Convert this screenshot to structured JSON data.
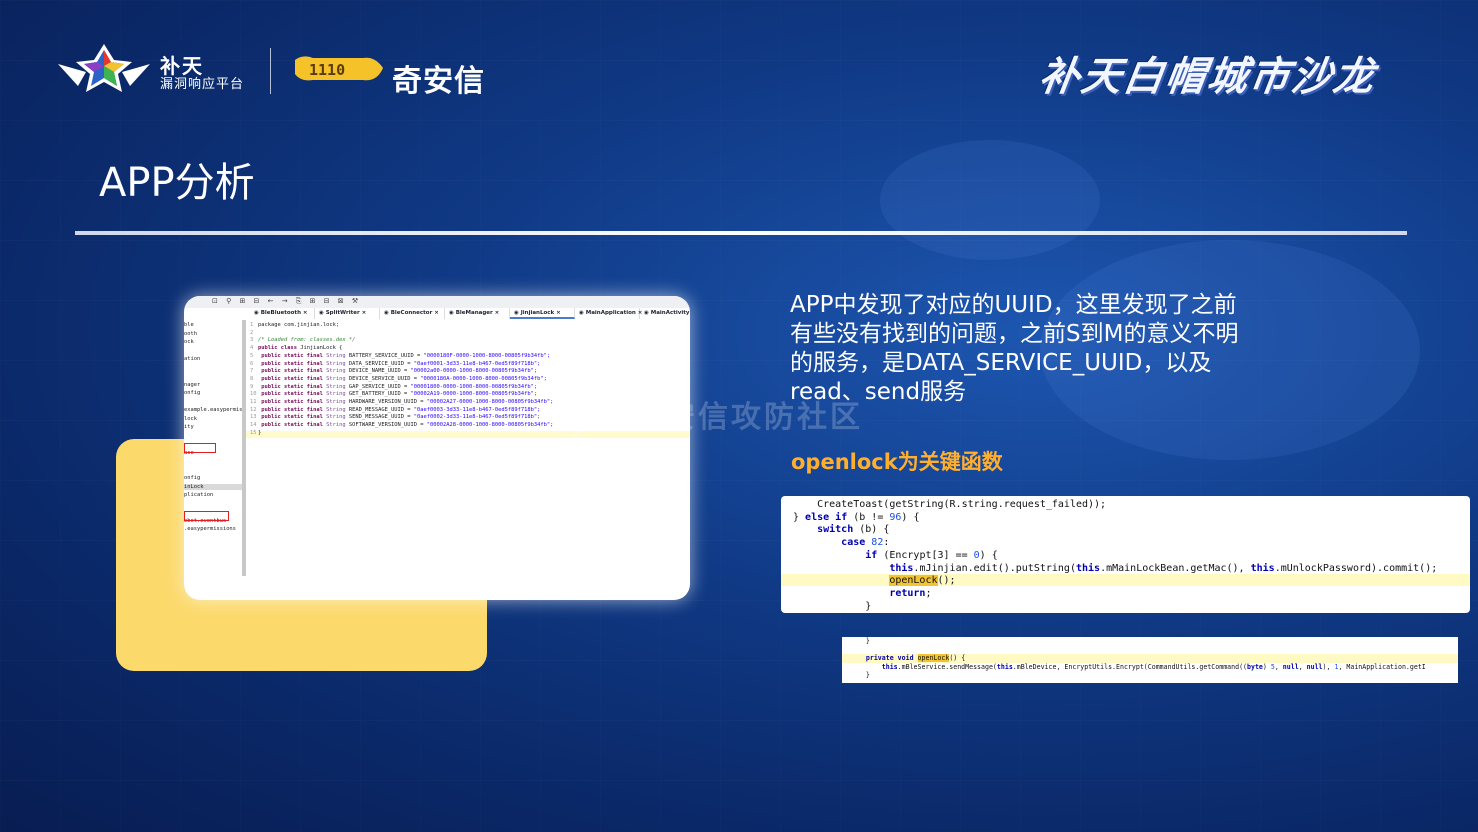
{
  "header": {
    "butian_line1": "补天",
    "butian_line2": "漏洞响应平台",
    "qax_badge": "1110",
    "qax_name": "奇安信",
    "salon_title": "补天白帽城市沙龙"
  },
  "slide": {
    "title": "APP分析",
    "description": "APP中发现了对应的UUID，这里发现了之前有些没有找到的问题，之前S到M的意义不明的服务，是DATA_SERVICE_UUID，以及read、send服务",
    "key_function_note": "openlock为关键函数",
    "watermark": "奇安信攻防社区"
  },
  "ide": {
    "toolbar_icons": "⊡ ⚲ ⊞ ⊟ ← → ⎘ ⊞ ⊟ ⊠ ⚒",
    "tabs": [
      "BleBluetooth",
      "SplitWriter",
      "BleConnector",
      "BleManager",
      "JinjianLock",
      "MainApplication",
      "MainActivity"
    ],
    "active_tab_index": 4,
    "tree": [
      "ble",
      "ooth",
      "ock",
      "",
      "ation",
      "",
      "",
      "nager",
      "onfig",
      "",
      "example.easypermis",
      "lock",
      "ity",
      "",
      "",
      "ase",
      "",
      "",
      "onfig",
      "inLock",
      "plication",
      "",
      "",
      "obot.eventbus",
      ".easypermissions"
    ],
    "code": {
      "l1": "package com.jinjian.lock;",
      "l3": "/* Loaded from: classes.dex */",
      "l4": "JinjianLock",
      "fields": [
        {
          "name": "BATTERY_SERVICE_UUID",
          "value": "\"0000180F-0000-1000-8000-00805f9b34fb\";"
        },
        {
          "name": "DATA_SERVICE_UUID",
          "value": "\"0aef0001-3d33-11e8-b467-0ed5f89f718b\";"
        },
        {
          "name": "DEVICE_NAME_UUID",
          "value": "\"00002a00-0000-1000-8000-00805f9b34fb\";"
        },
        {
          "name": "DEVICE_SERVICE_UUID",
          "value": "\"0000180A-0000-1000-8000-00805f9b34fb\";"
        },
        {
          "name": "GAP_SERVICE_UUID",
          "value": "\"00001800-0000-1000-8000-00805f9b34fb\";"
        },
        {
          "name": "GET_BATTERY_UUID",
          "value": "\"00002A19-0000-1000-8000-00805f9b34fb\";"
        },
        {
          "name": "HARDWARE_VERSION_UUID",
          "value": "\"00002A27-0000-1000-8000-00805f9b34fb\";"
        },
        {
          "name": "READ_MESSAGE_UUID",
          "value": "\"0aef0003-3d33-11e8-b467-0ed5f89f718b\";"
        },
        {
          "name": "SEND_MESSAGE_UUID",
          "value": "\"0aef0002-3d33-11e8-b467-0ed5f89f718b\";"
        },
        {
          "name": "SOFTWARE_VERSION_UUID",
          "value": "\"00002A28-0000-1000-8000-00805f9b34fb\";"
        }
      ]
    }
  },
  "snippet1": {
    "lines": [
      "    CreateToast(getString(R.string.request_failed));",
      "} else if (b != 96) {",
      "    switch (b) {",
      "        case 82:",
      "            if (Encrypt[3] == 0) {",
      "                this.mJinjian.edit().putString(this.mMainLockBean.getMac(), this.mUnlockPassword).commit();",
      "                openLock();",
      "                return;",
      "            }"
    ]
  },
  "snippet2": {
    "lines": [
      "    }",
      "",
      "    private void openLock() {",
      "        this.mBleService.sendMessage(this.mBleDevice, EncryptUtils.Encrypt(CommandUtils.getCommand((byte) 5, null, null), 1, MainApplication.getI",
      "    }"
    ]
  },
  "colors": {
    "background": "#103a86",
    "yellow_box": "#fcd96b",
    "accent_orange": "#ffae2e",
    "highlight": "#fff9c4"
  }
}
